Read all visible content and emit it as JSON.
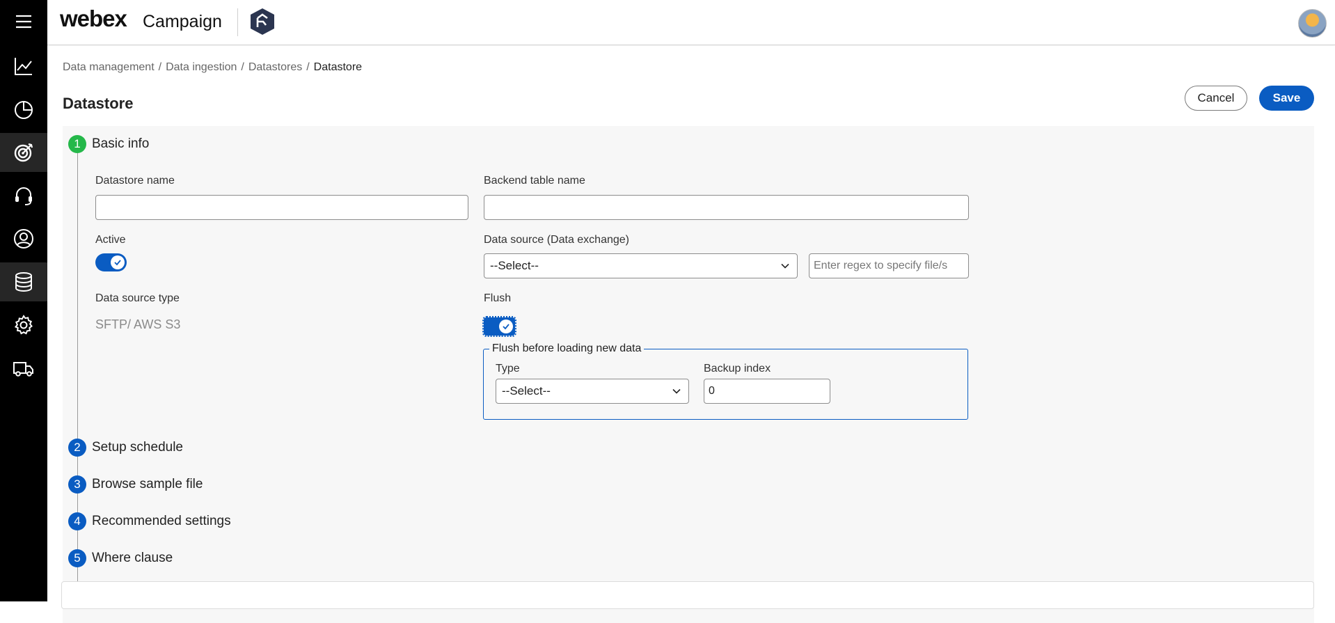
{
  "sidebar": {
    "items": [
      {
        "name": "menu-icon"
      },
      {
        "name": "analytics-line-chart-icon"
      },
      {
        "name": "pie-chart-icon"
      },
      {
        "name": "target-icon"
      },
      {
        "name": "headset-icon"
      },
      {
        "name": "user-circle-icon"
      },
      {
        "name": "database-icon"
      },
      {
        "name": "gear-icon"
      },
      {
        "name": "truck-icon"
      }
    ]
  },
  "header": {
    "brand": "webex",
    "product": "Campaign"
  },
  "breadcrumb": {
    "items": [
      "Data management",
      "Data ingestion",
      "Datastores"
    ],
    "separator": "/",
    "current": "Datastore"
  },
  "page": {
    "title": "Datastore",
    "cancel_label": "Cancel",
    "save_label": "Save"
  },
  "steps": [
    {
      "number": "1",
      "label": "Basic info",
      "status": "done"
    },
    {
      "number": "2",
      "label": "Setup schedule"
    },
    {
      "number": "3",
      "label": "Browse sample file"
    },
    {
      "number": "4",
      "label": "Recommended settings"
    },
    {
      "number": "5",
      "label": "Where clause"
    }
  ],
  "form": {
    "datastore_name_label": "Datastore name",
    "datastore_name_value": "",
    "backend_table_label": "Backend table name",
    "backend_table_value": "",
    "active_label": "Active",
    "active_on": true,
    "data_source_label": "Data source (Data exchange)",
    "data_source_value": "--Select--",
    "regex_placeholder": "Enter regex to specify file/s",
    "data_source_type_label": "Data source type",
    "data_source_type_value": "SFTP/ AWS S3",
    "flush_label": "Flush",
    "flush_on": true,
    "flush_group_legend": "Flush before loading new data",
    "type_label": "Type",
    "type_value": "--Select--",
    "backup_index_label": "Backup index",
    "backup_index_value": "0"
  },
  "colors": {
    "accent": "#0a5cc2",
    "success": "#25b84a",
    "sidebar_bg": "#000000"
  }
}
